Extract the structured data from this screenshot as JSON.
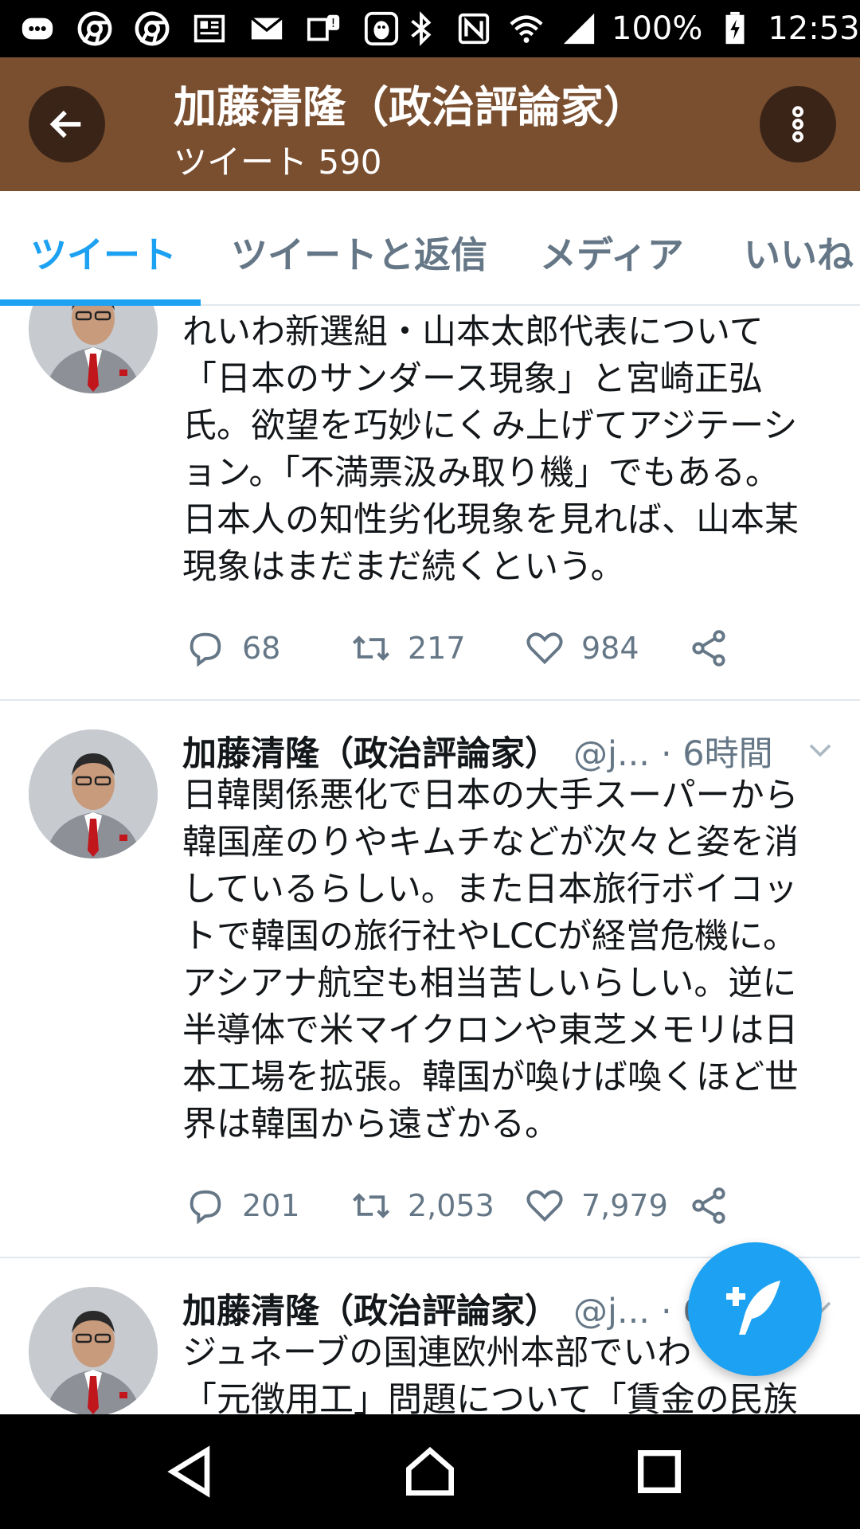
{
  "status_bar": {
    "battery": "100%",
    "time": "12:53",
    "left_icons": [
      "chat-bubble-icon",
      "chrome-icon",
      "chrome-icon",
      "news-icon",
      "mail-icon",
      "message-alert-icon",
      "bird-icon"
    ],
    "right_icons": [
      "bluetooth-icon",
      "nfc-icon",
      "wifi-icon",
      "cellular-signal-icon",
      "battery-charging-icon"
    ]
  },
  "header": {
    "title": "加藤清隆（政治評論家）",
    "subtitle": "ツイート 590",
    "bg_color": "#7a4f30",
    "back_icon": "arrow-left-icon",
    "more_icon": "more-vertical-icon"
  },
  "tabs": [
    {
      "label": "ツイート",
      "active": true
    },
    {
      "label": "ツイートと返信",
      "active": false
    },
    {
      "label": "メディア",
      "active": false
    },
    {
      "label": "いいね",
      "active": false
    }
  ],
  "accent_color": "#1da1f2",
  "tweets": [
    {
      "lines": [
        "れいわ新選組・山本太郎代表について",
        "「日本のサンダース現象」と宮崎正弘",
        "氏。欲望を巧妙にくみ上げてアジテーシ",
        "ョン。「不満票汲み取り機」でもある。",
        "日本人の知性劣化現象を見れば、山本某",
        "現象はまだまだ続くという。"
      ],
      "replies": "68",
      "retweets": "217",
      "likes": "984"
    },
    {
      "name": "加藤清隆（政治評論家）",
      "handle": "@j...",
      "time": "· 6時間",
      "lines": [
        "日韓関係悪化で日本の大手スーパーから",
        "韓国産のりやキムチなどが次々と姿を消",
        "しているらしい。また日本旅行ボイコッ",
        "トで韓国の旅行社やLCCが経営危機に。",
        "アシアナ航空も相当苦しいらしい。逆に",
        "半導体で米マイクロンや東芝メモリは日",
        "本工場を拡張。韓国が喚けば喚くほど世",
        "界は韓国から遠ざかる。"
      ],
      "replies": "201",
      "retweets": "2,053",
      "likes": "7,979"
    },
    {
      "name": "加藤清隆（政治評論家）",
      "handle": "@j...",
      "time": "· 6",
      "lines": [
        "ジュネーブの国連欧州本部でいわ",
        "「元徴用工」問題について「賃金の民族"
      ]
    }
  ],
  "fab_icon": "compose-tweet-icon",
  "nav": [
    "back-triangle-icon",
    "home-icon",
    "recents-square-icon"
  ]
}
